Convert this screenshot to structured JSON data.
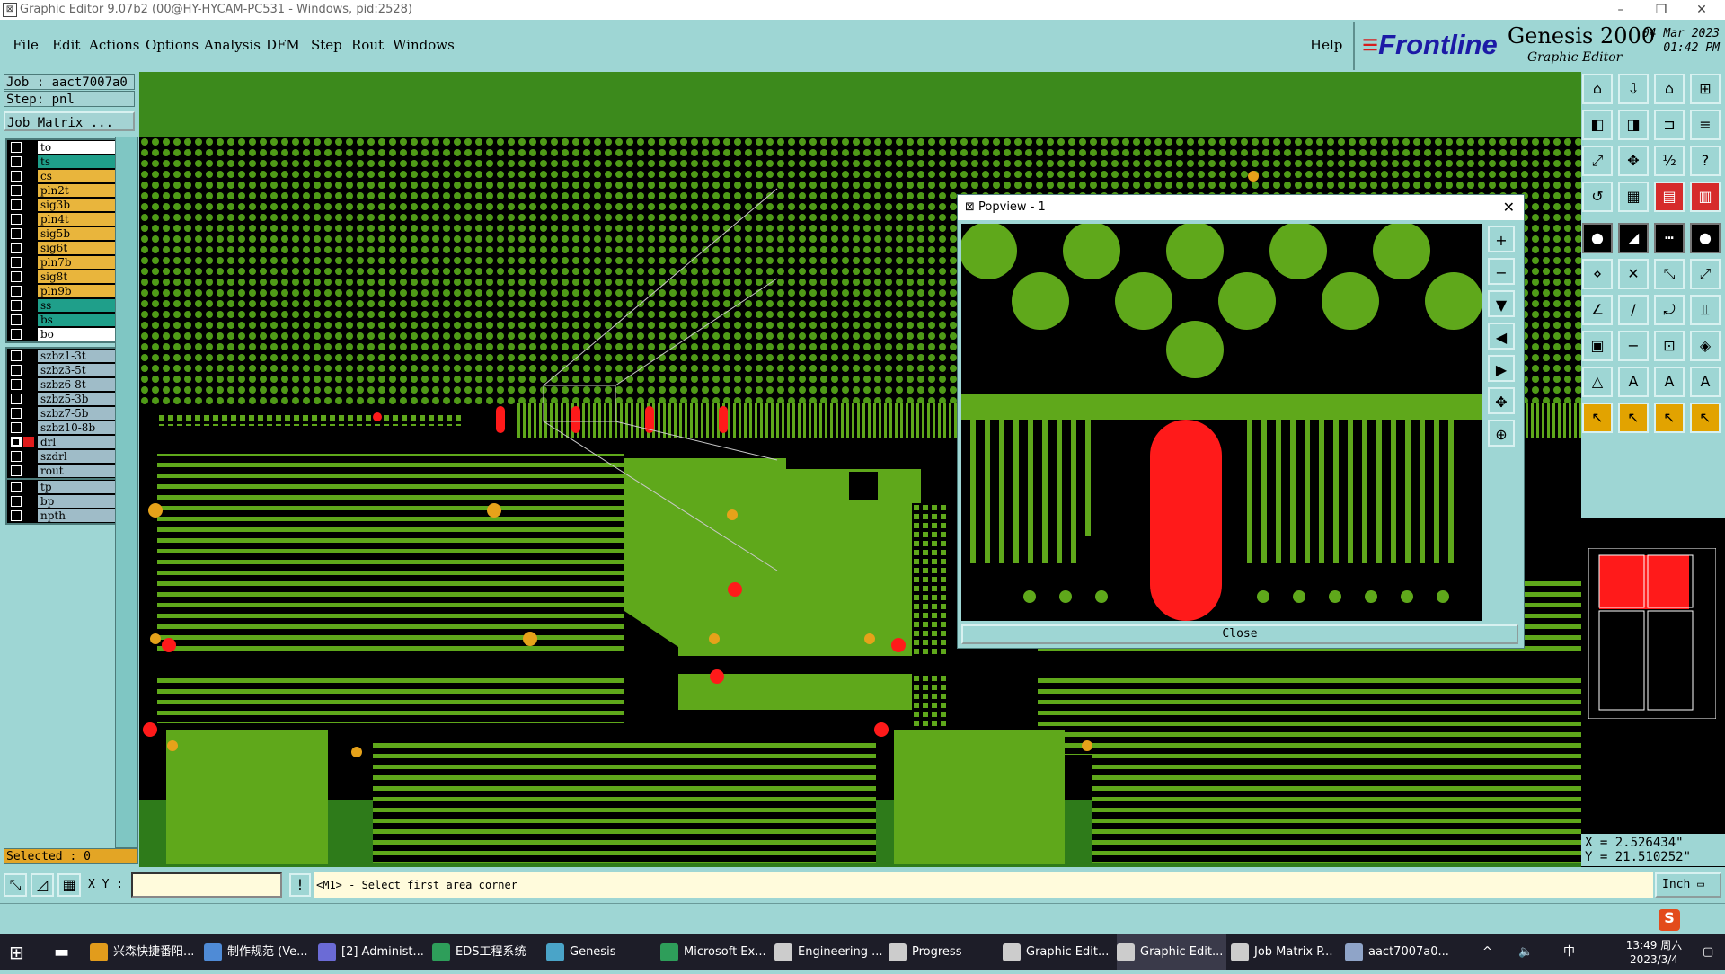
{
  "window": {
    "title": "Graphic Editor 9.07b2 (00@HY-HYCAM-PC531 - Windows, pid:2528)"
  },
  "menu": [
    "File",
    "Edit",
    "Actions",
    "Options",
    "Analysis",
    "DFM",
    "Step",
    "Rout",
    "Windows"
  ],
  "help_label": "Help",
  "brand": {
    "frontline": "Frontline",
    "product": "Genesis 2000",
    "subtitle": "Graphic Editor",
    "date": "04 Mar 2023",
    "time": "01:42 PM"
  },
  "job": {
    "job_line": "Job  : aact7007a0",
    "step_line": "Step: pnl",
    "matrix_button": "Job Matrix ..."
  },
  "layers_board": [
    {
      "name": "to",
      "color": "#ffffff"
    },
    {
      "name": "ts",
      "color": "#1f9f8a"
    },
    {
      "name": "cs",
      "color": "#e9b53c"
    },
    {
      "name": "pln2t",
      "color": "#e9b53c"
    },
    {
      "name": "sig3b",
      "color": "#e9b53c"
    },
    {
      "name": "pln4t",
      "color": "#e9b53c"
    },
    {
      "name": "sig5b",
      "color": "#e9b53c"
    },
    {
      "name": "sig6t",
      "color": "#e9b53c"
    },
    {
      "name": "pln7b",
      "color": "#e9b53c"
    },
    {
      "name": "sig8t",
      "color": "#e9b53c"
    },
    {
      "name": "pln9b",
      "color": "#e9b53c"
    },
    {
      "name": "ss",
      "color": "#1f9f8a"
    },
    {
      "name": "bs",
      "color": "#1f9f8a"
    },
    {
      "name": "bo",
      "color": "#ffffff"
    }
  ],
  "layers_drill": [
    {
      "name": "szbz1-3t",
      "color": "#9fbcc8"
    },
    {
      "name": "szbz3-5t",
      "color": "#9fbcc8"
    },
    {
      "name": "szbz6-8t",
      "color": "#9fbcc8"
    },
    {
      "name": "szbz5-3b",
      "color": "#9fbcc8"
    },
    {
      "name": "szbz7-5b",
      "color": "#9fbcc8"
    },
    {
      "name": "szbz10-8b",
      "color": "#9fbcc8"
    },
    {
      "name": "drl",
      "color": "#9fbcc8"
    },
    {
      "name": "szdrl",
      "color": "#9fbcc8"
    },
    {
      "name": "rout",
      "color": "#9fbcc8"
    }
  ],
  "layers_misc": [
    {
      "name": "tp",
      "color": "#9fbcc8"
    },
    {
      "name": "bp",
      "color": "#9fbcc8"
    },
    {
      "name": "npth",
      "color": "#9fbcc8"
    }
  ],
  "selected_text": "Selected : 0",
  "xy_label": "X Y :",
  "prompt_text": "<M1> - Select first area corner",
  "units": "Inch",
  "coords": {
    "x": "X = 2.526434\"",
    "y": "Y = 21.510252\""
  },
  "popview": {
    "title": "Popview - 1",
    "close_label": "Close"
  },
  "taskbar": {
    "items": [
      "兴森快捷番阳...",
      "制作规范 (Ve...",
      "[2] Administ...",
      "EDS工程系统",
      "Genesis",
      "Microsoft Ex...",
      "Engineering ...",
      "Progress",
      "Graphic Edit...",
      "Graphic Edit...",
      "Job Matrix P...",
      "aact7007a0..."
    ],
    "time": "13:49 周六",
    "date": "2023/3/4",
    "ime": "中"
  },
  "colors": {
    "board": "#2e7b1a",
    "copper": "#5fa81b",
    "highlight": "#ff1a1a",
    "panel": "#9ed6d4"
  }
}
